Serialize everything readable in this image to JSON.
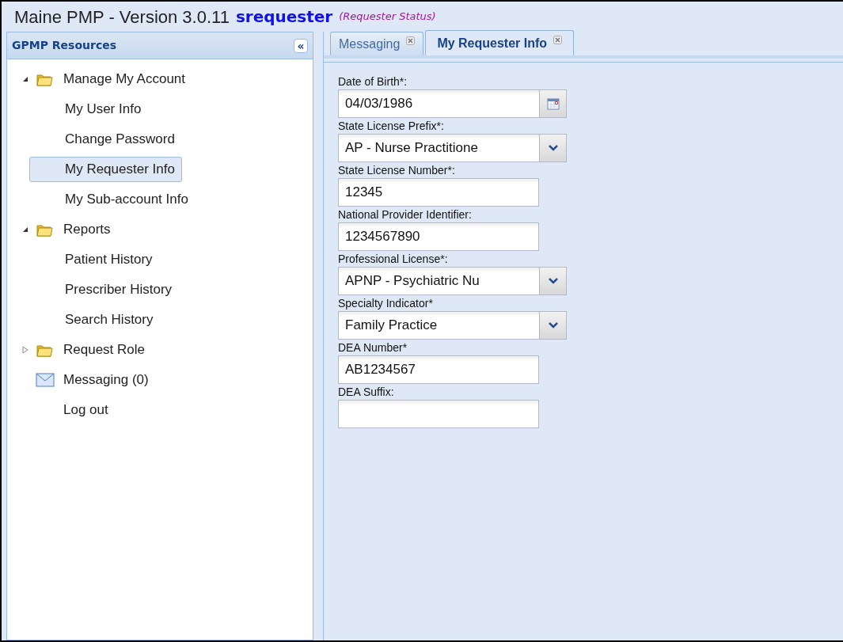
{
  "header": {
    "title": "Maine PMP - Version 3.0.11",
    "username": "srequester",
    "status": "(Requester Status)"
  },
  "sidebar": {
    "title": "GPMP Resources",
    "collapse_icon": "«",
    "items": [
      {
        "label": "Manage My Account",
        "kind": "folder",
        "expanded": true,
        "selected": false,
        "children": [
          {
            "label": "My User Info",
            "selected": false
          },
          {
            "label": "Change Password",
            "selected": false
          },
          {
            "label": "My Requester Info",
            "selected": true
          },
          {
            "label": "My Sub-account Info",
            "selected": false
          }
        ]
      },
      {
        "label": "Reports",
        "kind": "folder",
        "expanded": true,
        "selected": false,
        "children": [
          {
            "label": "Patient History",
            "selected": false
          },
          {
            "label": "Prescriber History",
            "selected": false
          },
          {
            "label": "Search History",
            "selected": false
          }
        ]
      },
      {
        "label": "Request Role",
        "kind": "folder",
        "expanded": false,
        "selected": false
      },
      {
        "label": "Messaging (0)",
        "kind": "mail",
        "selected": false
      },
      {
        "label": "Log out",
        "kind": "plain",
        "selected": false
      }
    ]
  },
  "tabs": [
    {
      "label": "Messaging",
      "selected": false
    },
    {
      "label": "My Requester Info",
      "selected": true
    }
  ],
  "form": {
    "fields": [
      {
        "label": "Date of Birth*:",
        "kind": "date",
        "value": "04/03/1986"
      },
      {
        "label": "State License Prefix*:",
        "kind": "combo",
        "value": "AP - Nurse Practitione"
      },
      {
        "label": "State License Number*:",
        "kind": "text",
        "value": "12345"
      },
      {
        "label": "National Provider Identifier:",
        "kind": "text",
        "value": "1234567890"
      },
      {
        "label": "Professional License*:",
        "kind": "combo",
        "value": "APNP - Psychiatric Nu"
      },
      {
        "label": "Specialty Indicator*",
        "kind": "combo",
        "value": "Family Practice"
      },
      {
        "label": "DEA Number*",
        "kind": "text",
        "value": "AB1234567"
      },
      {
        "label": "DEA Suffix:",
        "kind": "text"
      }
    ]
  }
}
